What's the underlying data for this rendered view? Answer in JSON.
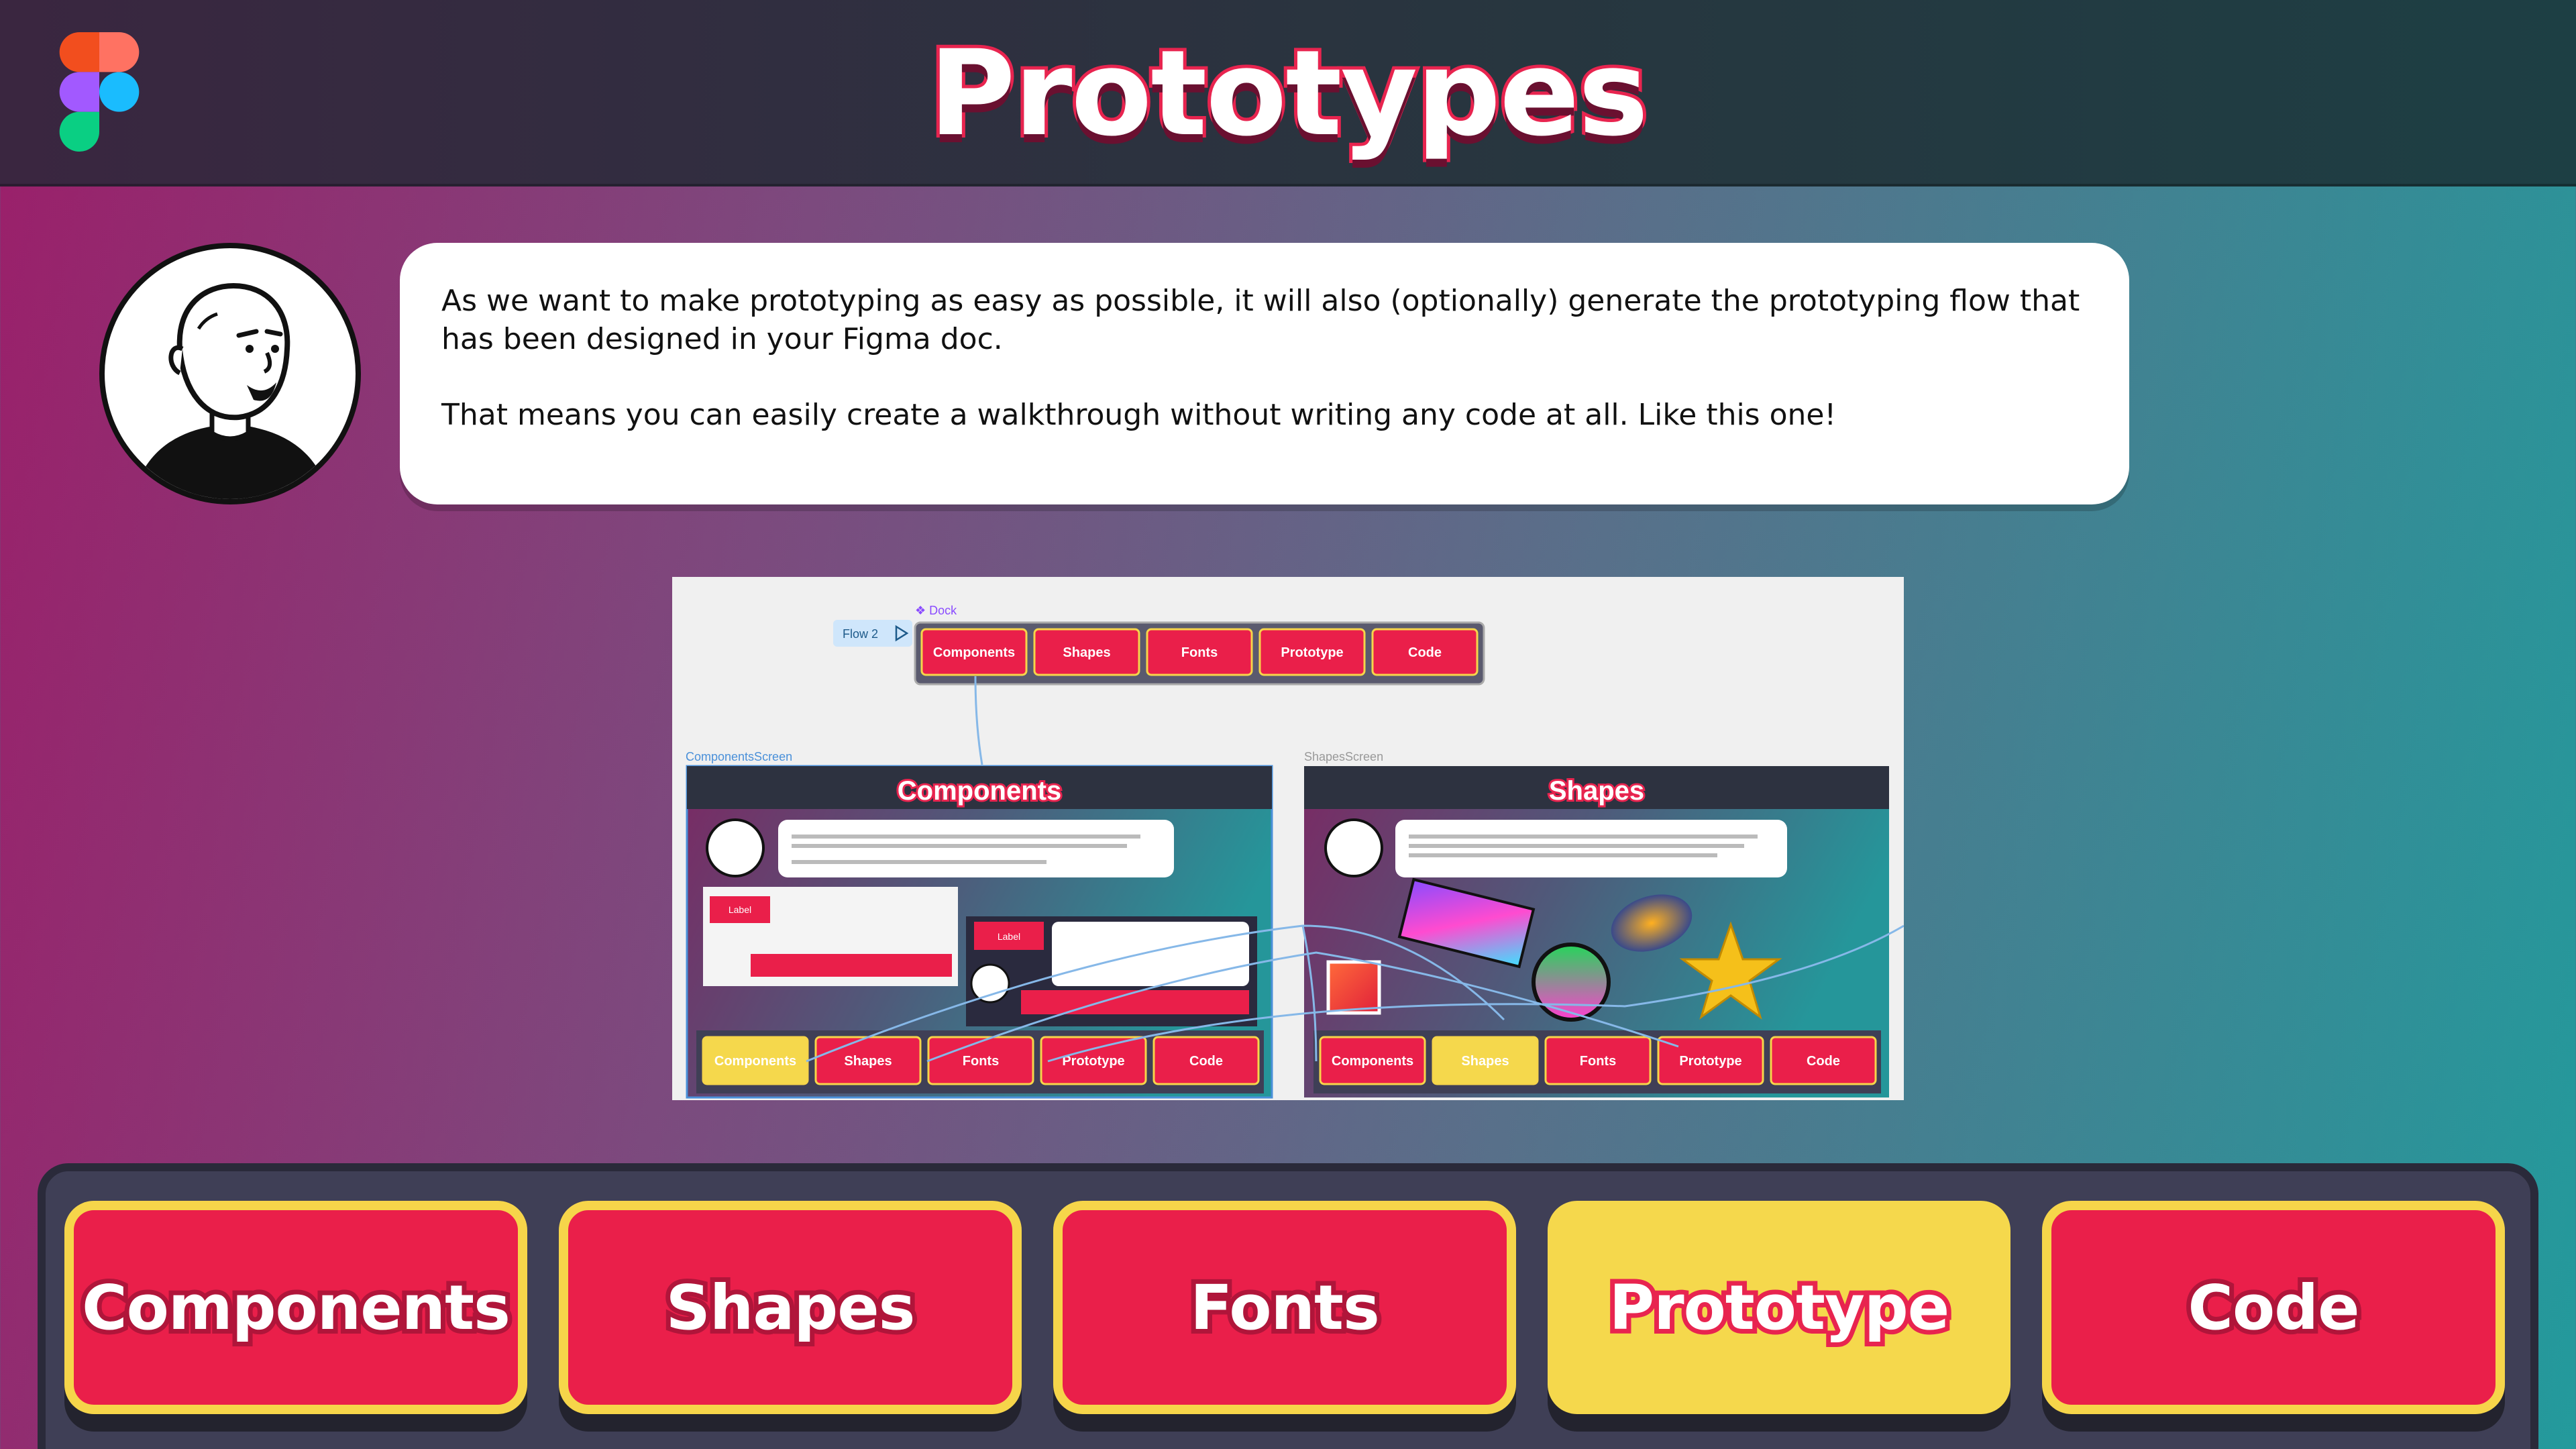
{
  "header": {
    "title": "Prototypes",
    "logo_icon": "figma-logo-icon"
  },
  "speaker": {
    "avatar_icon": "cartoon-avatar-icon",
    "paragraphs": [
      "As we want to make prototyping as easy as possible, it will also (optionally) generate the prototyping flow that has been designed in your Figma doc.",
      "That means you can easily create a walkthrough without writing any code at all. Like this one!"
    ]
  },
  "figma_preview": {
    "dock_label": "❖ Dock",
    "flow_label": "Flow 2",
    "top_buttons": [
      "Components",
      "Shapes",
      "Fonts",
      "Prototype",
      "Code"
    ],
    "frames": [
      {
        "frame_name": "ComponentsScreen",
        "title": "Components",
        "bottom_buttons": [
          "Components",
          "Shapes",
          "Fonts",
          "Prototype",
          "Code"
        ],
        "active": "Components"
      },
      {
        "frame_name": "ShapesScreen",
        "title": "Shapes",
        "bottom_buttons": [
          "Components",
          "Shapes",
          "Fonts",
          "Prototype",
          "Code"
        ],
        "active": "Shapes"
      }
    ],
    "inner_label": "Label"
  },
  "dock": {
    "buttons": [
      {
        "label": "Components",
        "active": false
      },
      {
        "label": "Shapes",
        "active": false
      },
      {
        "label": "Fonts",
        "active": false
      },
      {
        "label": "Prototype",
        "active": true
      },
      {
        "label": "Code",
        "active": false
      }
    ]
  },
  "colors": {
    "accent_red": "#ea1f4a",
    "accent_yellow": "#f5d84c",
    "dock_bg": "#3f3f56"
  }
}
